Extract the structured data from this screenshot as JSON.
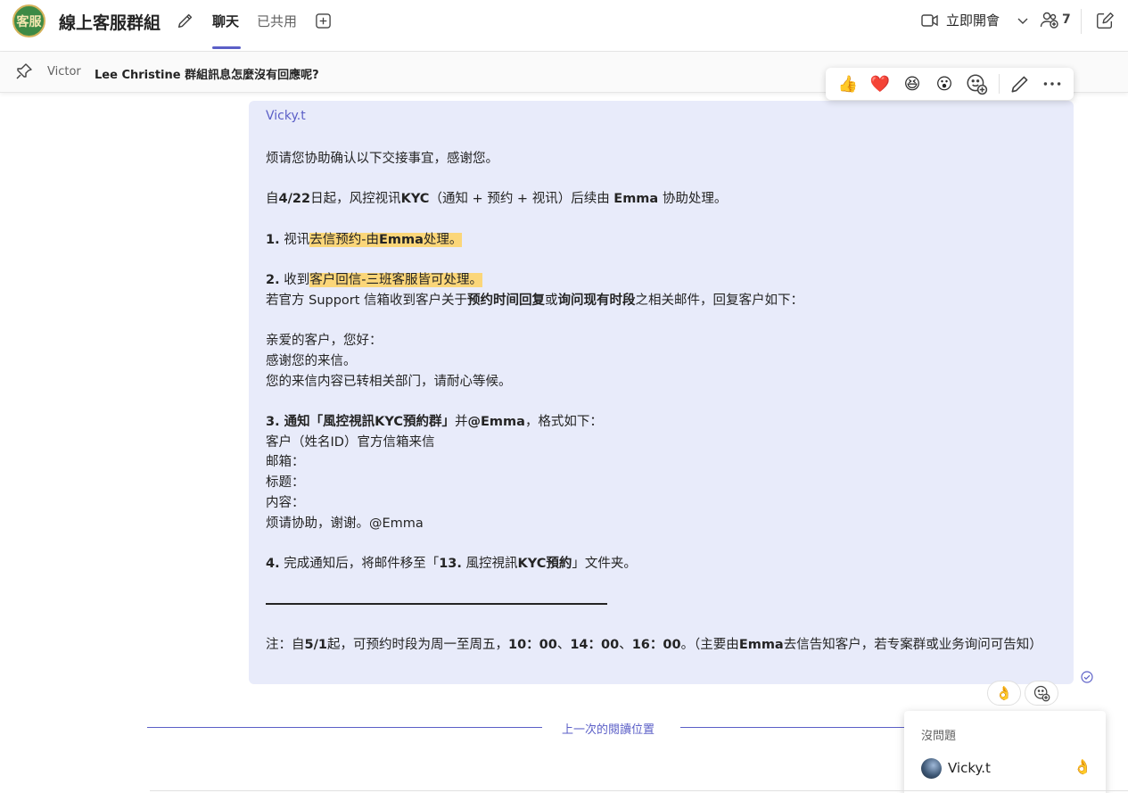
{
  "header": {
    "logo_text": "客服",
    "title": "線上客服群組",
    "tabs": [
      {
        "label": "聊天",
        "active": true
      },
      {
        "label": "已共用",
        "active": false
      }
    ],
    "meet_label": "立即開會",
    "people_count": "7"
  },
  "pinned": {
    "author": "Victor",
    "text": "Lee Christine 群組訊息怎麼沒有回應呢?"
  },
  "reaction_toolbar": {
    "emojis": [
      "👍",
      "❤️",
      "😆",
      "😮"
    ]
  },
  "message": {
    "sender": "Vicky.t",
    "intro": "烦请您协助确认以下交接事宜，感谢您。",
    "line2_pre": "自",
    "line2_date": "4/22",
    "line2_mid": "日起，风控视讯",
    "line2_kyc": "KYC",
    "line2_mid2": "（通知 + 预约 + 视讯）后续由 ",
    "line2_emma": "Emma",
    "line2_post": " 协助处理。",
    "item1_num": "1.",
    "item1_pre": " 视讯",
    "item1_hl": "去信预约-由",
    "item1_hl_b": "Emma",
    "item1_hl_post": "处理。",
    "item2_num": "2.",
    "item2_pre": " 收到",
    "item2_hl": "客户回信-三班客服皆可处理。",
    "item2_desc_pre": "若官方 Support 信箱收到客户关于",
    "item2_desc_b1": "预约时间回复",
    "item2_desc_mid": "或",
    "item2_desc_b2": "询问现有时段",
    "item2_desc_post": "之相关邮件，回复客户如下：",
    "reply1": "亲爱的客户，您好：",
    "reply2": "感谢您的来信。",
    "reply3": "您的来信内容已转相关部门，请耐心等候。",
    "item3_b": "3.  通知「風控視訊KYC預約群」",
    "item3_mid": "并",
    "item3_b2": "@Emma",
    "item3_post": "，格式如下：",
    "fmt1": "客户（姓名ID）官方信箱来信",
    "fmt2": "邮箱：",
    "fmt3": "标题：",
    "fmt4": "内容：",
    "fmt5": "烦请协助，谢谢。@Emma",
    "item4_num": "4.",
    "item4_pre": " 完成通知后，将邮件移至「",
    "item4_b": "13.",
    "item4_mid": " 風控視訊",
    "item4_b2": "KYC預約",
    "item4_post": "」文件夹。",
    "note_pre": "注：自",
    "note_b1": "5/1",
    "note_mid": "起，可预约时段为周一至周五，",
    "note_b2": "10：00",
    "note_sep1": "、",
    "note_b3": "14：00",
    "note_sep2": "、",
    "note_b4": "16：00",
    "note_mid2": "。（主要由",
    "note_b5": "Emma",
    "note_post": "去信告知客户，若专案群或业务询问可告知）"
  },
  "reactions": {
    "chip_emoji": "👌"
  },
  "last_read_label": "上一次的閱讀位置",
  "reaction_popup": {
    "title": "沒問題",
    "user": "Vicky.t",
    "emoji": "👌"
  },
  "colors": {
    "accent": "#5b5fc7",
    "bubble": "#e8ebfa",
    "highlight": "#fbd679"
  }
}
